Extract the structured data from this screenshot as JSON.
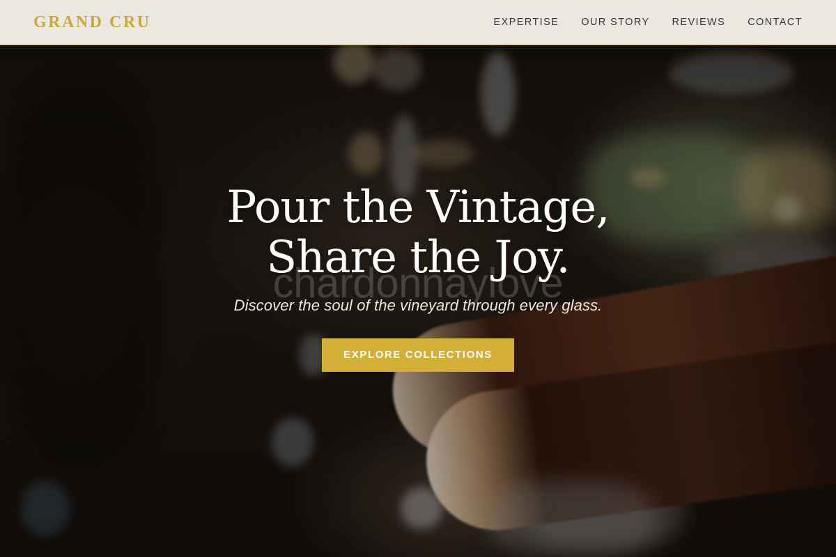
{
  "navbar": {
    "brand": "GRAND CRU",
    "links": [
      "EXPERTISE",
      "OUR STORY",
      "REVIEWS",
      "CONTACT"
    ]
  },
  "hero": {
    "headline_line1": "Pour the Vintage,",
    "headline_line2": "Share the Joy.",
    "ghost_text": "chardonnaylove",
    "tagline": "Discover the soul of the vineyard through every glass.",
    "cta_label": "EXPLORE COLLECTIONS",
    "background_image": "blurred-wine-cellar-bottles"
  },
  "colors": {
    "accent": "#d4af37",
    "brand": "#c9a83c",
    "navbar_bg": "#f8f6ee",
    "nav_text": "#3a3530"
  }
}
